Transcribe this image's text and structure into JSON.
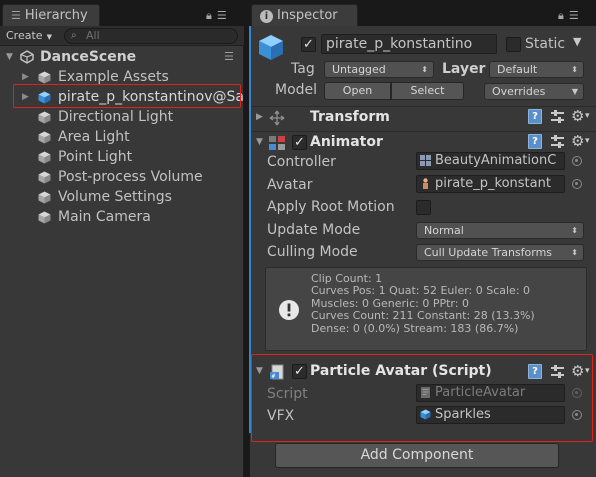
{
  "hierarchy": {
    "tab_title": "Hierarchy",
    "create_label": "Create",
    "search_placeholder": "All",
    "scene_name": "DanceScene",
    "items": [
      {
        "label": "Example Assets",
        "expandable": true,
        "selected": false
      },
      {
        "label": "pirate_p_konstantinov@Sa",
        "expandable": true,
        "selected": true
      },
      {
        "label": "Directional Light",
        "expandable": false,
        "selected": false
      },
      {
        "label": "Area Light",
        "expandable": false,
        "selected": false
      },
      {
        "label": "Point Light",
        "expandable": false,
        "selected": false
      },
      {
        "label": "Post-process Volume",
        "expandable": false,
        "selected": false
      },
      {
        "label": "Volume Settings",
        "expandable": false,
        "selected": false
      },
      {
        "label": "Main Camera",
        "expandable": false,
        "selected": false
      }
    ]
  },
  "inspector": {
    "tab_title": "Inspector",
    "object": {
      "name": "pirate_p_konstantino",
      "active": true,
      "static_label": "Static",
      "static_checked": false,
      "tag_label": "Tag",
      "tag_value": "Untagged",
      "layer_label": "Layer",
      "layer_value": "Default",
      "model_label": "Model",
      "open_label": "Open",
      "select_label": "Select",
      "overrides_label": "Overrides"
    },
    "transform": {
      "title": "Transform"
    },
    "animator": {
      "title": "Animator",
      "enabled": true,
      "controller_label": "Controller",
      "controller_value": "BeautyAnimationC",
      "avatar_label": "Avatar",
      "avatar_value": "pirate_p_konstant",
      "apply_root_motion_label": "Apply Root Motion",
      "apply_root_motion": false,
      "update_mode_label": "Update Mode",
      "update_mode_value": "Normal",
      "culling_mode_label": "Culling Mode",
      "culling_mode_value": "Cull Update Transforms",
      "info": [
        "Clip Count: 1",
        "Curves Pos: 1 Quat: 52 Euler: 0 Scale: 0",
        "Muscles: 0 Generic: 0 PPtr: 0",
        "Curves Count: 211 Constant: 28 (13.3%)",
        "Dense: 0 (0.0%) Stream: 183 (86.7%)"
      ]
    },
    "particle_avatar": {
      "title": "Particle Avatar (Script)",
      "enabled": true,
      "script_label": "Script",
      "script_value": "ParticleAvatar",
      "vfx_label": "VFX",
      "vfx_value": "Sparkles"
    },
    "add_component_label": "Add Component"
  },
  "colors": {
    "panel_bg": "#383838",
    "highlight": "#e0231a",
    "accent_blue": "#3b83c8"
  },
  "icons": [
    "lock-icon",
    "menu-icon",
    "info-icon",
    "unity-logo-icon",
    "gameobject-cube-icon",
    "help-book-icon",
    "presets-icon",
    "gear-icon",
    "animator-component-icon",
    "script-component-icon",
    "warning-icon",
    "object-picker-icon"
  ]
}
